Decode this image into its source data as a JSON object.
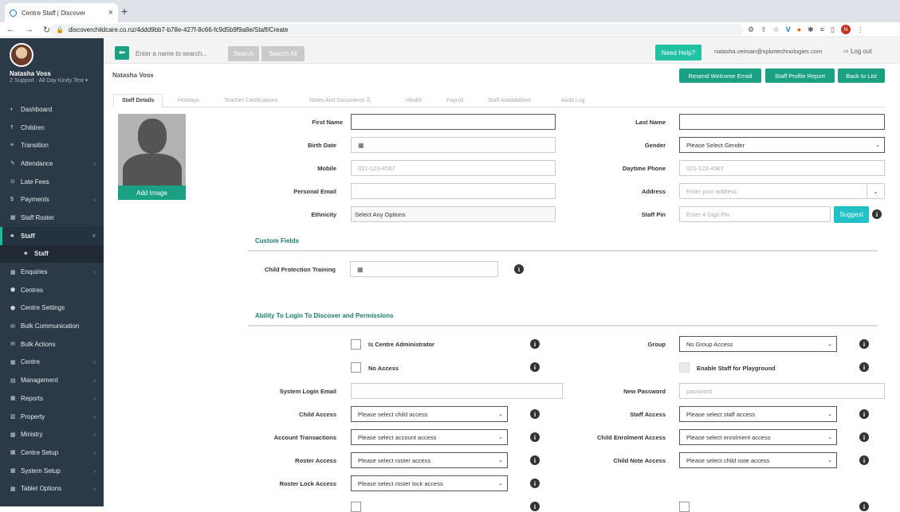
{
  "browser": {
    "tab_title": "Centre Staff | Discover",
    "url": "discoverchildcare.co.nz/4ddd9bb7-b78e-427f-8c66-fc9d5b9f9a8e/Staff/Create",
    "profile_initial": "N"
  },
  "sidebar": {
    "user_name": "Natasha Voss",
    "user_sub": "Z Support · All Day Kindy Test ▾",
    "items": [
      {
        "label": "Dashboard",
        "icon": "◐"
      },
      {
        "label": "Children",
        "icon": "☨"
      },
      {
        "label": "Transition",
        "icon": "≡"
      },
      {
        "label": "Attendance",
        "icon": "✎",
        "chevron": "‹"
      },
      {
        "label": "Late Fees",
        "icon": "⊙"
      },
      {
        "label": "Payments",
        "icon": "$",
        "chevron": "‹"
      },
      {
        "label": "Staff Roster",
        "icon": "▦"
      },
      {
        "label": "Staff",
        "icon": "♣",
        "chevron": "˅"
      },
      {
        "label": "Staff",
        "icon": "♣"
      },
      {
        "label": "Enquiries",
        "icon": "▦",
        "chevron": "‹"
      },
      {
        "label": "Centres",
        "icon": "⬟"
      },
      {
        "label": "Centre Settings",
        "icon": "⬟"
      },
      {
        "label": "Bulk Communication",
        "icon": "✉"
      },
      {
        "label": "Bulk Actions",
        "icon": "✉"
      },
      {
        "label": "Centre",
        "icon": "▦",
        "chevron": "‹"
      },
      {
        "label": "Management",
        "icon": "▤",
        "chevron": "‹"
      },
      {
        "label": "Reports",
        "icon": "▦",
        "chevron": "‹"
      },
      {
        "label": "Property",
        "icon": "▥",
        "chevron": "‹"
      },
      {
        "label": "Ministry",
        "icon": "▦",
        "chevron": "‹"
      },
      {
        "label": "Centre Setup",
        "icon": "▦",
        "chevron": "‹"
      },
      {
        "label": "System Setup",
        "icon": "▦",
        "chevron": "‹"
      },
      {
        "label": "Tablet Options",
        "icon": "▦",
        "chevron": "‹"
      }
    ]
  },
  "topbar": {
    "search_placeholder": "Enter a name to search...",
    "search_label": "Search",
    "search_all_label": "Search All",
    "need_help": "Need Help?",
    "email": "natasha.veiman@xplortechnologies.com",
    "logout": "Log out"
  },
  "header": {
    "name": "Natasha Voss",
    "resend": "Resend Welcome Email",
    "profile_report": "Staff Profile Report",
    "back": "Back to List"
  },
  "tabs": [
    "Staff Details",
    "Holidays",
    "Teacher Certifications",
    "Notes And Documents ⎘",
    "Health",
    "Payroll",
    "Staff Availabilities",
    "Audit Log"
  ],
  "details": {
    "add_image": "Add Image",
    "first_name": "First Name",
    "last_name": "Last Name",
    "birth_date": "Birth Date",
    "gender": "Gender",
    "gender_value": "Please Select Gender",
    "mobile": "Mobile",
    "mobile_ph": "021-123-4567",
    "daytime_phone": "Daytime Phone",
    "daytime_ph": "021-123-4567",
    "personal_email": "Personal Email",
    "address": "Address",
    "address_ph": "Enter your address",
    "ethnicity": "Ethnicity",
    "ethnicity_value": "Select Any Options",
    "staff_pin": "Staff Pin",
    "staff_pin_ph": "Enter 4 Digit Pin",
    "suggest": "Suggest"
  },
  "custom": {
    "title": "Custom Fields",
    "cpt_label": "Child Protection Training"
  },
  "perm": {
    "title": "Ability To Login To Discover and Permissions",
    "centre_admin": "Is Centre Administrator",
    "no_access": "No Access",
    "group": "Group",
    "group_value": "No Group Access",
    "playground": "Enable Staff for Playground",
    "login_email": "System Login Email",
    "new_password": "New Password",
    "password_ph": "password",
    "child_access": "Child Access",
    "child_access_value": "Please select child access",
    "staff_access": "Staff Access",
    "staff_access_value": "Please select staff access",
    "account_tx": "Account Transactions",
    "account_tx_value": "Please select account access",
    "child_enrol": "Child Enrolment Access",
    "child_enrol_value": "Please select enrolment access",
    "roster_access": "Roster Access",
    "roster_access_value": "Please select roster access",
    "child_note": "Child Note Access",
    "child_note_value": "Please select child note access",
    "roster_lock": "Roster Lock Access",
    "roster_lock_value": "Please select roster lock access"
  }
}
